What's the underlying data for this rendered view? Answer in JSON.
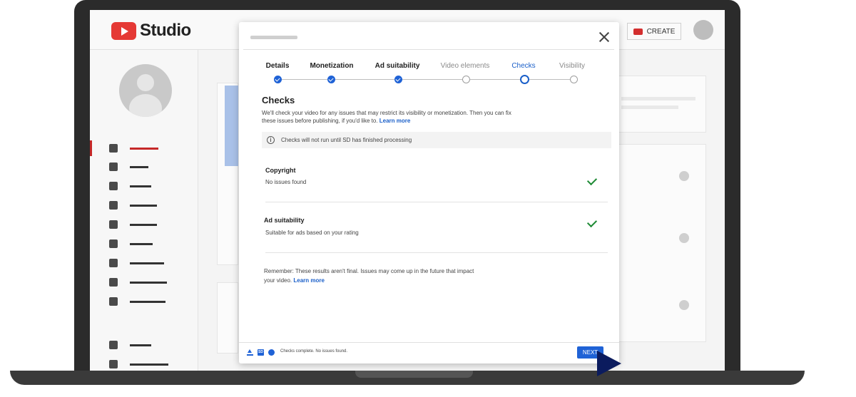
{
  "app": {
    "name": "Studio",
    "create_label": "CREATE"
  },
  "modal": {
    "steps": [
      {
        "label": "Details",
        "state": "done"
      },
      {
        "label": "Monetization",
        "state": "done"
      },
      {
        "label": "Ad suitability",
        "state": "done"
      },
      {
        "label": "Video elements",
        "state": "todo"
      },
      {
        "label": "Checks",
        "state": "current"
      },
      {
        "label": "Visibility",
        "state": "todo"
      }
    ],
    "heading": "Checks",
    "description": "We'll check your video for any issues that may restrict its visibility or monetization. Then you can fix these issues before publishing, if you'd like to.",
    "learn_more": "Learn more",
    "notice": "Checks will not run until SD has finished processing",
    "copyright_title": "Copyright",
    "copyright_status": "No issues found",
    "ad_title": "Ad suitability",
    "ad_status": "Suitable for ads based on your rating",
    "remember": "Remember: These results aren't final. Issues may come up in the future that impact your video.",
    "remember_link": "Learn more",
    "footer_status": "Checks complete. No issues found.",
    "sd_badge": "SD",
    "next_label": "NEXT"
  },
  "colors": {
    "accent": "#1f62d6",
    "brand_red": "#e53935",
    "success": "#1e8a35"
  },
  "icons": {
    "close": "close-icon",
    "info": "info-icon",
    "check": "checkmark-icon",
    "upload": "upload-icon"
  }
}
